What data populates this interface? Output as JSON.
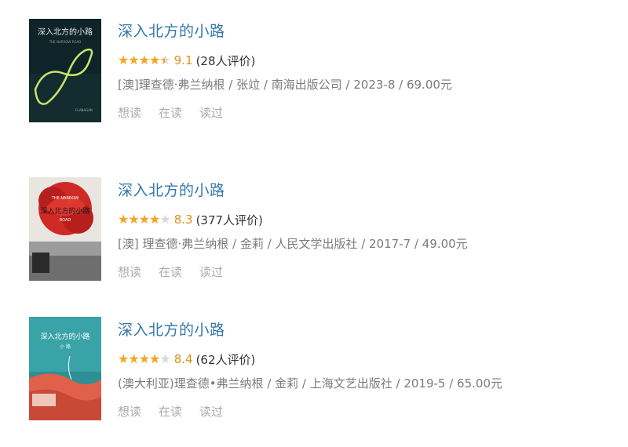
{
  "books": [
    {
      "title": "深入北方的小路",
      "rating_stars": 4.5,
      "score": "9.1",
      "rating_count": "(28人评价)",
      "pub": "[澳]理查德·弗兰纳根 / 张竝 / 南海出版公司 / 2023-8 / 69.00元",
      "actions": [
        "想读",
        "在读",
        "读过"
      ],
      "cover_title": "深入北方的小路"
    },
    {
      "title": "深入北方的小路",
      "rating_stars": 4,
      "score": "8.3",
      "rating_count": "(377人评价)",
      "pub": "[澳] 理查德·弗兰纳根 / 金莉 / 人民文学出版社 / 2017-7 / 49.00元",
      "actions": [
        "想读",
        "在读",
        "读过"
      ],
      "cover_title": "深入北方的小路"
    },
    {
      "title": "深入北方的小路",
      "rating_stars": 4,
      "score": "8.4",
      "rating_count": "(62人评价)",
      "pub": "(澳大利亚)理查德•弗兰纳根 / 金莉 / 上海文艺出版社 / 2019-5 / 65.00元",
      "actions": [
        "想读",
        "在读",
        "读过"
      ],
      "cover_title": "深入北方的小路"
    }
  ],
  "colors": {
    "title_link": "#3377aa",
    "star": "#f4a621",
    "score": "#e09015",
    "meta": "#7b7b7b",
    "action": "#aaaaaa"
  }
}
